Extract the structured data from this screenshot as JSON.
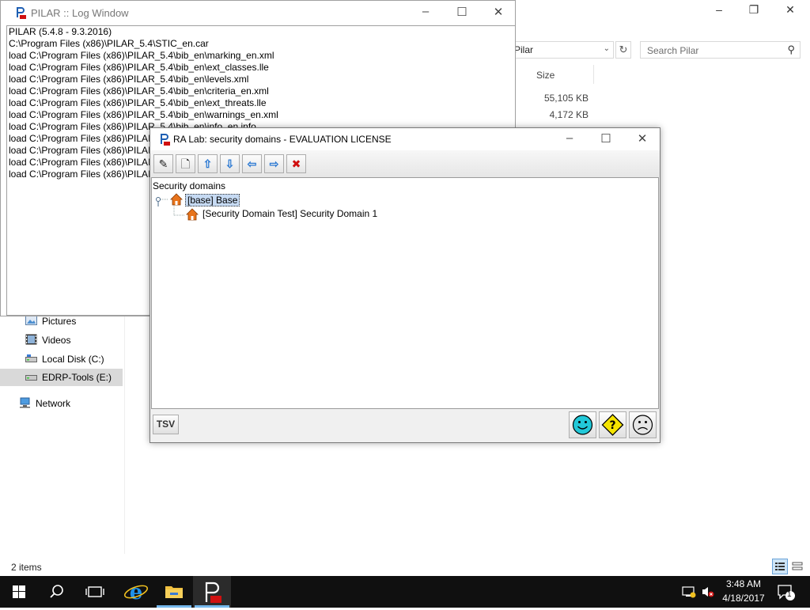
{
  "explorer": {
    "path_text": "Pilar",
    "search_placeholder": "Search Pilar",
    "column_size": "Size",
    "sizes": [
      "55,105 KB",
      "4,172 KB"
    ],
    "nav_items": [
      {
        "label": "Pictures"
      },
      {
        "label": "Videos"
      },
      {
        "label": "Local Disk (C:)"
      },
      {
        "label": "EDRP-Tools (E:)"
      },
      {
        "label": "Network"
      }
    ],
    "status": "2 items"
  },
  "log_window": {
    "title": "PILAR :: Log Window",
    "lines": [
      "PILAR (5.4.8 - 9.3.2016)",
      "C:\\Program Files (x86)\\PILAR_5.4\\STIC_en.car",
      "load C:\\Program Files (x86)\\PILAR_5.4\\bib_en\\marking_en.xml",
      "load C:\\Program Files (x86)\\PILAR_5.4\\bib_en\\ext_classes.lle",
      "load C:\\Program Files (x86)\\PILAR_5.4\\bib_en\\levels.xml",
      "load C:\\Program Files (x86)\\PILAR_5.4\\bib_en\\criteria_en.xml",
      "load C:\\Program Files (x86)\\PILAR_5.4\\bib_en\\ext_threats.lle",
      "load C:\\Program Files (x86)\\PILAR_5.4\\bib_en\\warnings_en.xml",
      "load C:\\Program Files (x86)\\PILAR_5.4\\bib_en\\info_en.info",
      "load C:\\Program Files (x86)\\PILAI",
      "load C:\\Program Files (x86)\\PILAI",
      "load C:\\Program Files (x86)\\PILAI",
      "load C:\\Program Files (x86)\\PILAI"
    ]
  },
  "ra_lab": {
    "title": "RA Lab: security domains - EVALUATION LICENSE",
    "toolbar": [
      {
        "icon": "edit-icon",
        "glyph": "✎"
      },
      {
        "icon": "new-document-icon",
        "glyph": "🗋"
      },
      {
        "icon": "arrow-up-icon",
        "glyph": "⇧"
      },
      {
        "icon": "arrow-down-icon",
        "glyph": "⇩"
      },
      {
        "icon": "arrow-left-icon",
        "glyph": "⇦"
      },
      {
        "icon": "arrow-right-icon",
        "glyph": "⇨"
      },
      {
        "icon": "delete-icon",
        "glyph": "✖"
      }
    ],
    "tree_root": "Security domains",
    "node_base": "[base] Base",
    "node_child": "[Security Domain Test] Security Domain 1",
    "tsv_label": "TSV"
  },
  "taskbar": {
    "time": "3:48 AM",
    "date": "4/18/2017",
    "notification_count": "1"
  },
  "colors": {
    "taskbar": "#101010",
    "selection": "#c6daf3",
    "house": "#e8741c",
    "arrow_blue": "#2a78d2",
    "delete_red": "#d01010"
  }
}
